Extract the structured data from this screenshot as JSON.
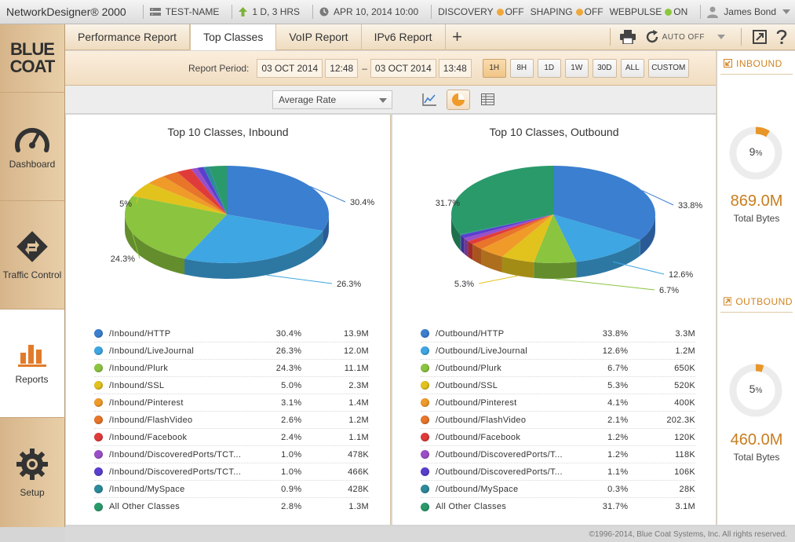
{
  "topbar": {
    "app_title": "NetworkDesigner® 2000",
    "device": "TEST-NAME",
    "uptime": "1 D, 3 HRS",
    "date": "APR 10, 2014 10:00",
    "discovery_label": "DISCOVERY",
    "discovery_state": "OFF",
    "shaping_label": "SHAPING",
    "shaping_state": "OFF",
    "webpulse_label": "WEBPULSE",
    "webpulse_state": "ON",
    "user": "James Bond",
    "colors": {
      "off": "#f0a83c",
      "on": "#8cc63e"
    }
  },
  "sidebar": {
    "logo_line1": "BLUE",
    "logo_line2": "COAT",
    "items": [
      {
        "label": "Dashboard",
        "icon": "gauge-icon"
      },
      {
        "label": "Traffic Control",
        "icon": "traffic-sign-icon"
      },
      {
        "label": "Reports",
        "icon": "bar-chart-icon"
      },
      {
        "label": "Setup",
        "icon": "gear-icon"
      }
    ]
  },
  "tabs": {
    "items": [
      "Performance Report",
      "Top Classes",
      "VoIP Report",
      "IPv6 Report"
    ],
    "active": "Top Classes",
    "add": "+",
    "auto_label": "AUTO OFF"
  },
  "period": {
    "label": "Report Period:",
    "start_date": "03 OCT 2014",
    "start_time": "12:48",
    "separator": "–",
    "end_date": "03 OCT 2014",
    "end_time": "13:48",
    "ranges": [
      "1H",
      "8H",
      "1D",
      "1W",
      "30D",
      "ALL",
      "CUSTOM"
    ],
    "active_range": "1H"
  },
  "view": {
    "metric": "Average Rate"
  },
  "chart_data": [
    {
      "type": "pie",
      "title": "Top 10 Classes, Inbound",
      "categories": [
        "/Inbound/HTTP",
        "/Inbound/LiveJournal",
        "/Inbound/Plurk",
        "/Inbound/SSL",
        "/Inbound/Pinterest",
        "/Inbound/FlashVideo",
        "/Inbound/Facebook",
        "/Inbound/DiscoveredPorts/TCT...",
        "/Inbound/DiscoveredPorts/TCT...",
        "/Inbound/MySpace",
        "All Other Classes"
      ],
      "values": [
        30.4,
        26.3,
        24.3,
        5.0,
        3.1,
        2.6,
        2.4,
        1.0,
        1.0,
        0.9,
        2.8
      ],
      "pct_labels": [
        "30.4%",
        "26.3%",
        "24.3%",
        "5.0%",
        "3.1%",
        "2.6%",
        "2.4%",
        "1.0%",
        "1.0%",
        "0.9%",
        "2.8%"
      ],
      "amounts": [
        "13.9M",
        "12.0M",
        "11.1M",
        "2.3M",
        "1.4M",
        "1.2M",
        "1.1M",
        "478K",
        "466K",
        "428K",
        "1.3M"
      ],
      "callouts": [
        "30.4%",
        "26.3%",
        "24.3%",
        "5%"
      ]
    },
    {
      "type": "pie",
      "title": "Top 10 Classes, Outbound",
      "categories": [
        "/Outbound/HTTP",
        "/Outbound/LiveJournal",
        "/Outbound/Plurk",
        "/Outbound/SSL",
        "/Outbound/Pinterest",
        "/Outbound/FlashVideo",
        "/Outbound/Facebook",
        "/Outbound/DiscoveredPorts/T...",
        "/Outbound/DiscoveredPorts/T...",
        "/Outbound/MySpace",
        "All Other Classes"
      ],
      "values": [
        33.8,
        12.6,
        6.7,
        5.3,
        4.1,
        2.1,
        1.2,
        1.2,
        1.1,
        0.3,
        31.7
      ],
      "pct_labels": [
        "33.8%",
        "12.6%",
        "6.7%",
        "5.3%",
        "4.1%",
        "2.1%",
        "1.2%",
        "1.2%",
        "1.1%",
        "0.3%",
        "31.7%"
      ],
      "amounts": [
        "3.3M",
        "1.2M",
        "650K",
        "520K",
        "400K",
        "202.3K",
        "120K",
        "118K",
        "106K",
        "28K",
        "3.1M"
      ],
      "callouts": [
        "33.8%",
        "12.6%",
        "6.7%",
        "5.3%",
        "31.7%"
      ]
    }
  ],
  "series_colors": [
    "#3b7fd0",
    "#3ea6e2",
    "#8bc43f",
    "#e2c21d",
    "#f09a2a",
    "#e87529",
    "#e03b3b",
    "#9b4fc7",
    "#5a3fcf",
    "#2d8a9a",
    "#2a9a6a"
  ],
  "summary": {
    "inbound": {
      "heading": "INBOUND",
      "percent": 9,
      "percent_text": "9",
      "unit": "%",
      "total": "869.0M",
      "total_label": "Total Bytes"
    },
    "outbound": {
      "heading": "OUTBOUND",
      "percent": 5,
      "percent_text": "5",
      "unit": "%",
      "total": "460.0M",
      "total_label": "Total Bytes"
    }
  },
  "footer": "©1996-2014, Blue Coat Systems, Inc. All rights reserved."
}
